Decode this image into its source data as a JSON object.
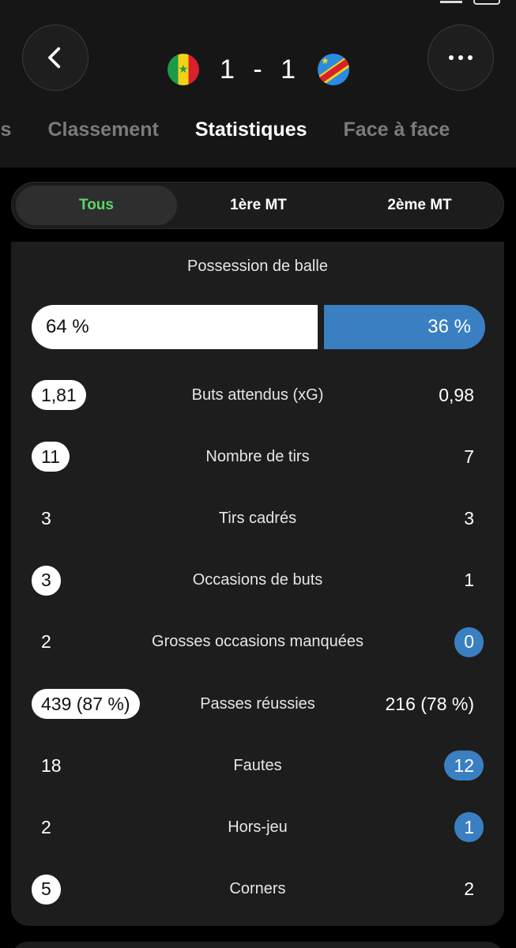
{
  "match": {
    "home_score": "1",
    "separator": "-",
    "away_score": "1",
    "home_team_flag": "senegal-flag",
    "away_team_flag": "dr-congo-flag"
  },
  "tabs": [
    "ons",
    "Classement",
    "Statistiques",
    "Face à face"
  ],
  "active_tab": "Statistiques",
  "period_filter": {
    "options": [
      "Tous",
      "1ère MT",
      "2ème MT"
    ],
    "selected": "Tous"
  },
  "possession": {
    "title": "Possession de balle",
    "home_label": "64 %",
    "away_label": "36 %",
    "home_fraction": 0.64
  },
  "stats": [
    {
      "label": "Buts attendus (xG)",
      "home": "1,81",
      "away": "0,98",
      "leader": "home"
    },
    {
      "label": "Nombre de tirs",
      "home": "11",
      "away": "7",
      "leader": "home"
    },
    {
      "label": "Tirs cadrés",
      "home": "3",
      "away": "3",
      "leader": "none"
    },
    {
      "label": "Occasions de buts",
      "home": "3",
      "away": "1",
      "leader": "home"
    },
    {
      "label": "Grosses occasions manquées",
      "home": "2",
      "away": "0",
      "leader": "away"
    },
    {
      "label": "Passes réussies",
      "home": "439 (87 %)",
      "away": "216 (78 %)",
      "leader": "home"
    },
    {
      "label": "Fautes",
      "home": "18",
      "away": "12",
      "leader": "away"
    },
    {
      "label": "Hors-jeu",
      "home": "2",
      "away": "1",
      "leader": "away"
    },
    {
      "label": "Corners",
      "home": "5",
      "away": "2",
      "leader": "home"
    }
  ],
  "colors": {
    "home_accent": "#ffffff",
    "away_accent": "#3a7fc1",
    "active_filter_text": "#5cd667",
    "background": "#000000",
    "card": "#1d1d1d"
  }
}
